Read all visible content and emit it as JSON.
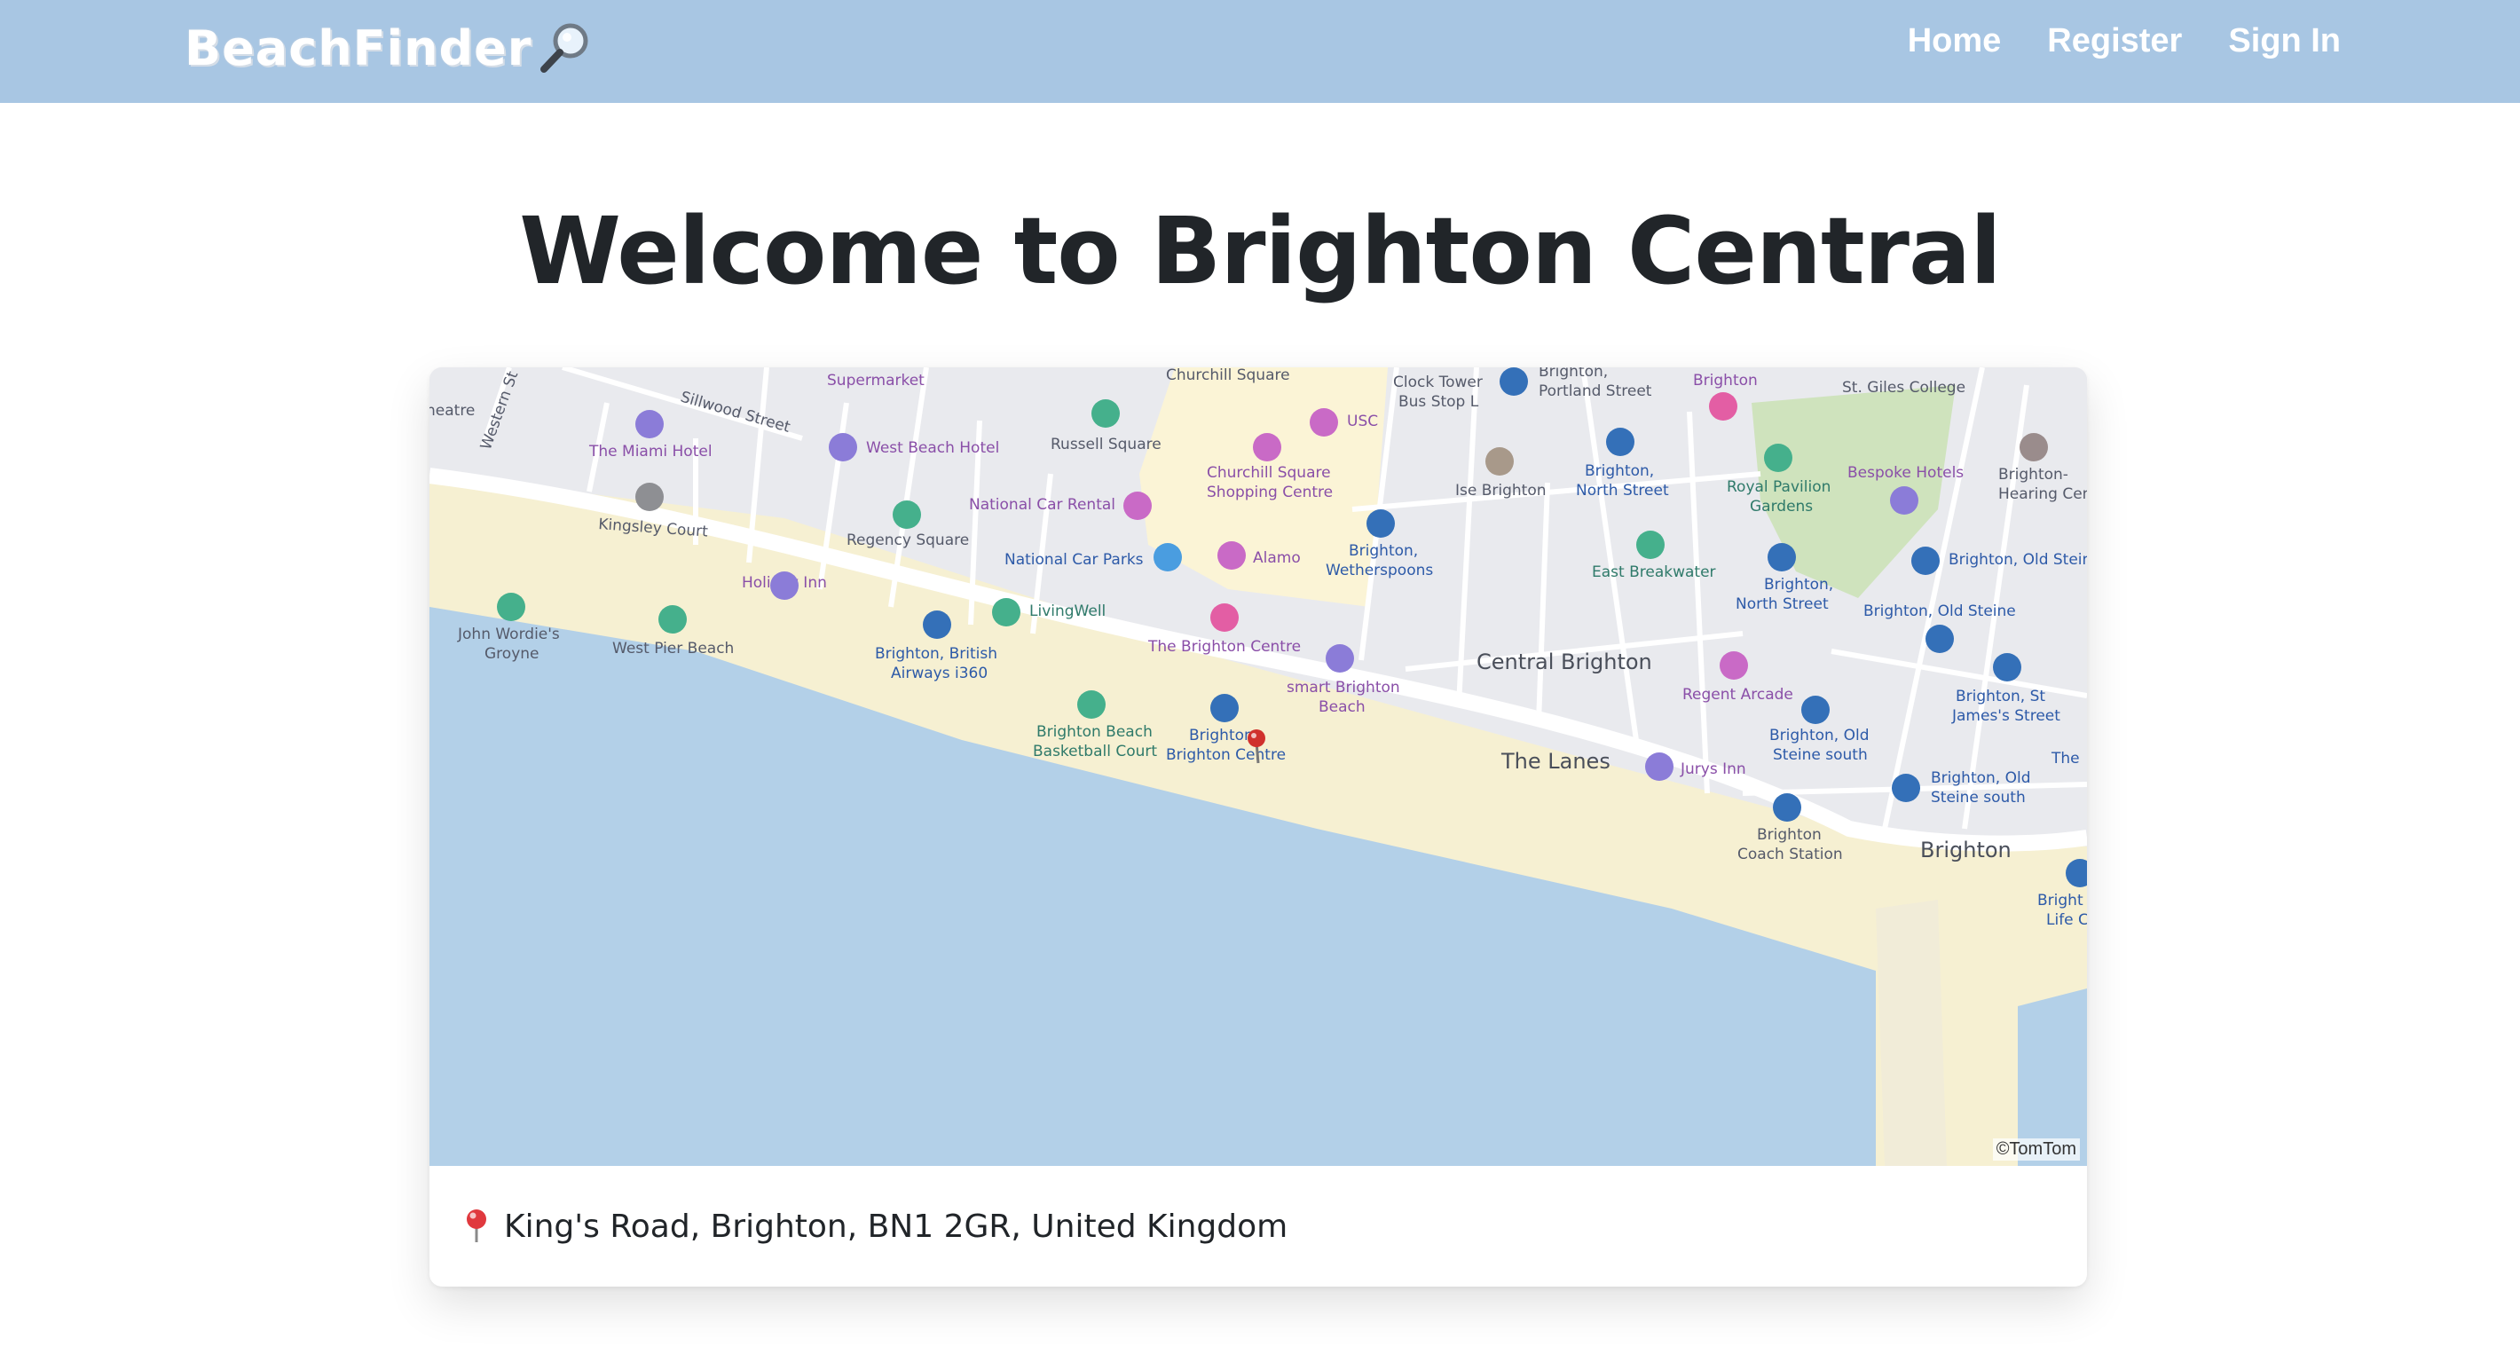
{
  "navbar": {
    "brand": "BeachFinder",
    "brand_icon": "magnifying-glass-icon",
    "links": [
      {
        "label": "Home"
      },
      {
        "label": "Register"
      },
      {
        "label": "Sign In"
      }
    ]
  },
  "page": {
    "title": "Welcome to Brighton Central"
  },
  "map": {
    "attribution": "©TomTom",
    "marker_icon": "red-pushpin-icon",
    "labels": {
      "western_st": "Western St",
      "sillwood": "Sillwood Street",
      "theatre": "heatre",
      "supermarket": "Supermarket",
      "churchill_square": "Churchill Square",
      "usc": "USC",
      "clock_tower": "Clock Tower",
      "bus_stop_l": "Bus Stop L",
      "brighton_portland_1": "Brighton,",
      "brighton_portland_2": "Portland Street",
      "brighton_top": "Brighton",
      "st_giles": "St. Giles College",
      "miami_hotel": "The Miami Hotel",
      "west_beach_hotel": "West Beach Hotel",
      "russell_square": "Russell Square",
      "churchill_sc_1": "Churchill Square",
      "churchill_sc_2": "Shopping Centre",
      "ise_brighton": "Ise Brighton",
      "brighton_north_1": "Brighton,",
      "brighton_north_2": "North Street",
      "royal_pavilion_1": "Royal Pavilion",
      "royal_pavilion_2": "Gardens",
      "bespoke_hotels": "Bespoke Hotels",
      "hearing_1": "Brighton-",
      "hearing_2": "Hearing Centr",
      "kingsley_court": "Kingsley Court",
      "national_car_rental": "National Car Rental",
      "regency_square": "Regency Square",
      "national_car_parks": "National Car Parks",
      "alamo": "Alamo",
      "brighton_wether_1": "Brighton,",
      "brighton_wether_2": "Wetherspoons",
      "east_breakwater": "East Breakwater",
      "brighton_north2_1": "Brighton,",
      "brighton_north2_2": "North Street",
      "brighton_old_steine_a": "Brighton, Old Stein",
      "brighton_old_steine_b": "Brighton, Old Steine",
      "holiday_inn": "Holiday Inn",
      "john_wordie_1": "John Wordie's",
      "john_wordie_2": "Groyne",
      "west_pier_beach": "West Pier Beach",
      "british_airways_1": "Brighton, British",
      "british_airways_2": "Airways i360",
      "livingwell": "LivingWell",
      "brighton_centre": "The Brighton Centre",
      "smart_brighton_1": "smart Brighton",
      "smart_brighton_2": "Beach",
      "central_brighton": "Central Brighton",
      "regent_arcade": "Regent Arcade",
      "st_james_1": "Brighton, St",
      "st_james_2": "James's Street",
      "basketball_1": "Brighton Beach",
      "basketball_2": "Basketball Court",
      "brighton_centre_stop_1": "Brighton,",
      "brighton_centre_stop_2": "Brighton Centre",
      "the_lanes": "The Lanes",
      "jurys_inn": "Jurys Inn",
      "old_steine_south_1": "Brighton, Old",
      "old_steine_south_2": "Steine south",
      "the_partial": "The",
      "old_steine_south2_1": "Brighton, Old",
      "old_steine_south2_2": "Steine south",
      "coach_station_1": "Brighton",
      "coach_station_2": "Coach Station",
      "brighton_main": "Brighton",
      "life_1": "Bright",
      "life_2": "Life C"
    }
  },
  "location": {
    "pin_icon": "round-pushpin-icon",
    "address": "King's Road, Brighton, BN1 2GR, United Kingdom"
  },
  "colors": {
    "navbar": "#a8c6e3",
    "sea": "#b3d0e8",
    "beach": "#f6f0d2",
    "land": "#e9eaee",
    "park": "#cfe3bd",
    "shopping": "#fbf4d6"
  }
}
